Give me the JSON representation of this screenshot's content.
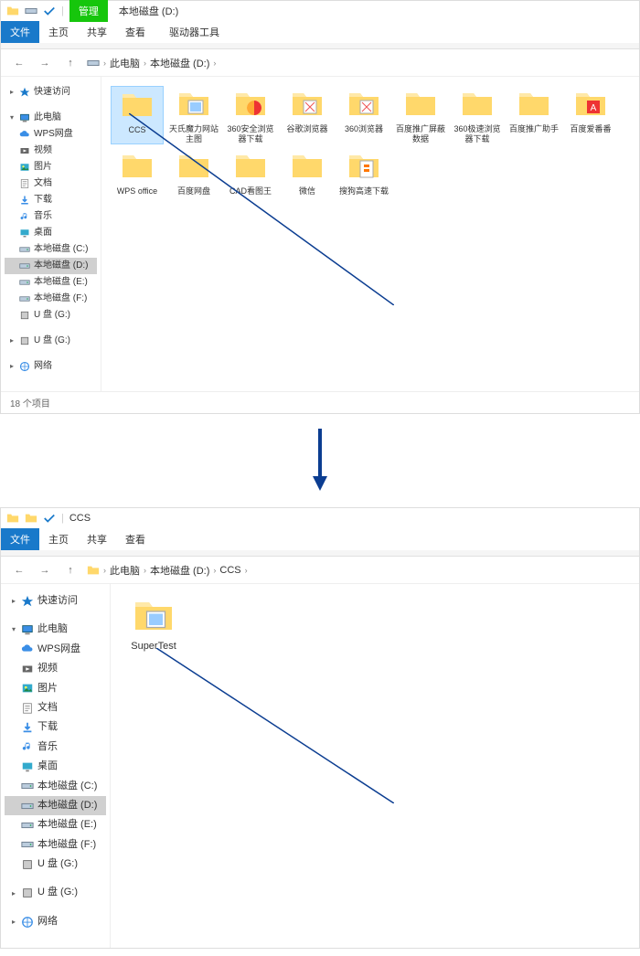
{
  "win1": {
    "title": "本地磁盘 (D:)",
    "manage_tab": "管理",
    "menu": {
      "file": "文件",
      "home": "主页",
      "share": "共享",
      "view": "查看",
      "drive_tools": "驱动器工具"
    },
    "breadcrumb": {
      "this_pc": "此电脑",
      "drive": "本地磁盘 (D:)"
    },
    "sidebar": {
      "quick_access": "快速访问",
      "this_pc": "此电脑",
      "items": [
        {
          "label": "WPS网盘",
          "icon": "cloud"
        },
        {
          "label": "视频",
          "icon": "video"
        },
        {
          "label": "图片",
          "icon": "pictures"
        },
        {
          "label": "文档",
          "icon": "documents"
        },
        {
          "label": "下载",
          "icon": "downloads"
        },
        {
          "label": "音乐",
          "icon": "music"
        },
        {
          "label": "桌面",
          "icon": "desktop"
        },
        {
          "label": "本地磁盘 (C:)",
          "icon": "drive"
        },
        {
          "label": "本地磁盘 (D:)",
          "icon": "drive",
          "selected": true
        },
        {
          "label": "本地磁盘 (E:)",
          "icon": "drive"
        },
        {
          "label": "本地磁盘 (F:)",
          "icon": "drive"
        },
        {
          "label": "U 盘 (G:)",
          "icon": "usb"
        }
      ],
      "usb": "U 盘 (G:)",
      "network": "网络"
    },
    "folders": [
      {
        "label": "CCS",
        "selected": true,
        "icon": "folder"
      },
      {
        "label": "天氏魔力网站主图",
        "icon": "folder-img"
      },
      {
        "label": "360安全浏览器下载",
        "icon": "folder-360"
      },
      {
        "label": "谷歌浏览器",
        "icon": "folder-app"
      },
      {
        "label": "360浏览器",
        "icon": "folder-app"
      },
      {
        "label": "百度推广屏蔽数据",
        "icon": "folder"
      },
      {
        "label": "360极速浏览器下载",
        "icon": "folder"
      },
      {
        "label": "百度推广助手",
        "icon": "folder"
      },
      {
        "label": "百度爱番番",
        "icon": "folder-red"
      },
      {
        "label": "WPS office",
        "icon": "folder"
      },
      {
        "label": "百度网盘",
        "icon": "folder"
      },
      {
        "label": "CAD看图王",
        "icon": "folder"
      },
      {
        "label": "微信",
        "icon": "folder"
      },
      {
        "label": "搜狗高速下载",
        "icon": "folder-sogou"
      }
    ],
    "status": "18 个项目"
  },
  "win2": {
    "title": "CCS",
    "menu": {
      "file": "文件",
      "home": "主页",
      "share": "共享",
      "view": "查看"
    },
    "breadcrumb": {
      "this_pc": "此电脑",
      "drive": "本地磁盘 (D:)",
      "folder": "CCS"
    },
    "sidebar": {
      "quick_access": "快速访问",
      "this_pc": "此电脑",
      "items": [
        {
          "label": "WPS网盘",
          "icon": "cloud"
        },
        {
          "label": "视频",
          "icon": "video"
        },
        {
          "label": "图片",
          "icon": "pictures"
        },
        {
          "label": "文档",
          "icon": "documents"
        },
        {
          "label": "下载",
          "icon": "downloads"
        },
        {
          "label": "音乐",
          "icon": "music"
        },
        {
          "label": "桌面",
          "icon": "desktop"
        },
        {
          "label": "本地磁盘 (C:)",
          "icon": "drive"
        },
        {
          "label": "本地磁盘 (D:)",
          "icon": "drive",
          "selected": true
        },
        {
          "label": "本地磁盘 (E:)",
          "icon": "drive"
        },
        {
          "label": "本地磁盘 (F:)",
          "icon": "drive"
        },
        {
          "label": "U 盘 (G:)",
          "icon": "usb"
        }
      ],
      "usb": "U 盘 (G:)",
      "network": "网络"
    },
    "folders": [
      {
        "label": "SuperTest",
        "icon": "folder-img"
      }
    ]
  },
  "colors": {
    "blue": "#1979ca",
    "green": "#16c60c",
    "folder": "#ffd86b",
    "arrow": "#0b3d91"
  }
}
